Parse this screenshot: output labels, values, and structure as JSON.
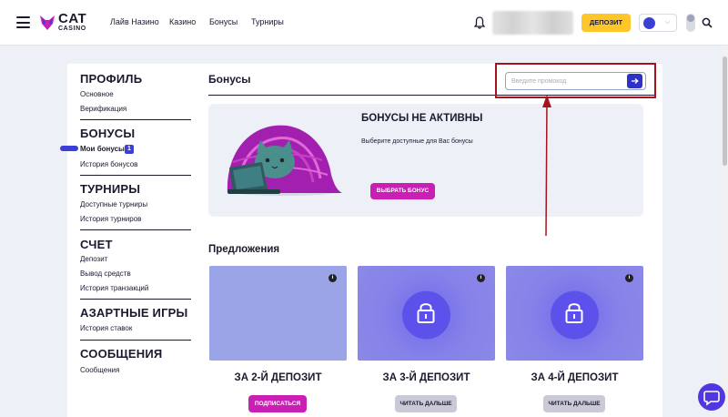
{
  "header": {
    "logo_main": "CAT",
    "logo_sub": "CASINO",
    "nav": [
      "Лайв Назино",
      "Казино",
      "Бонусы",
      "Турниры"
    ],
    "deposit_label": "ДЕПОЗИТ",
    "icons": [
      "menu-icon",
      "bell-icon",
      "globe-icon",
      "chevron-down-icon",
      "search-icon"
    ]
  },
  "sidebar": {
    "sections": [
      {
        "title": "ПРОФИЛЬ",
        "items": [
          "Основное",
          "Верификация"
        ]
      },
      {
        "title": "БОНУСЫ",
        "items": [
          "Мои бонусы",
          "История бонусов"
        ]
      },
      {
        "title": "ТУРНИРЫ",
        "items": [
          "Доступные турниры",
          "История турниров"
        ]
      },
      {
        "title": "СЧЕТ",
        "items": [
          "Депозит",
          "Вывод средств",
          "История транзакций"
        ]
      },
      {
        "title": "АЗАРТНЫЕ ИГРЫ",
        "items": [
          "История ставок"
        ]
      },
      {
        "title": "СООБЩЕНИЯ",
        "items": [
          "Сообщения"
        ]
      }
    ],
    "active_item": "Мои бонусы",
    "active_badge": "1"
  },
  "main": {
    "title": "Бонусы",
    "promo": {
      "placeholder": "Введите промокод",
      "value": ""
    },
    "banner": {
      "title": "БОНУСЫ НЕ АКТИВНЫ",
      "subtitle": "Выберите доступные для Вас бонусы",
      "button": "ВЫБРАТЬ БОНУС"
    },
    "offers_title": "Предложения",
    "offers": [
      {
        "title": "ЗА 2-Й ДЕПОЗИТ",
        "button": "ПОДПИСАТЬСЯ",
        "locked": false,
        "info": "i"
      },
      {
        "title": "ЗА 3-Й ДЕПОЗИТ",
        "button": "ЧИТАТЬ ДАЛЬШЕ",
        "locked": true,
        "info": "i"
      },
      {
        "title": "ЗА 4-Й ДЕПОЗИТ",
        "button": "ЧИТАТЬ ДАЛЬШЕ",
        "locked": true,
        "info": "i"
      }
    ]
  },
  "colors": {
    "accent": "#c91fb5",
    "primary": "#2e31c7",
    "deposit": "#ffc629",
    "highlight_box": "#a5141c"
  }
}
